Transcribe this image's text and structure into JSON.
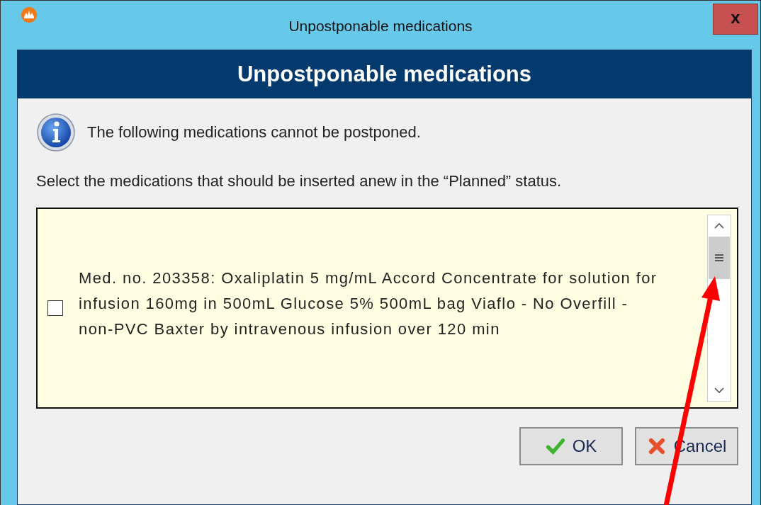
{
  "window": {
    "title": "Unpostponable medications",
    "close": "x"
  },
  "header": "Unpostponable medications",
  "info_text": "The following medications cannot be postponed.",
  "instruction": "Select the medications that should be inserted anew in the “Planned” status.",
  "items": [
    {
      "text": "Med. no. 203358: Oxaliplatin 5 mg/mL Accord Concentrate for solution for infusion 160mg in 500mL Glucose 5% 500mL bag Viaflo - No Overfill - non-PVC Baxter by intravenous infusion over 120 min",
      "checked": false
    }
  ],
  "buttons": [
    {
      "label": "OK",
      "kind": "ok"
    },
    {
      "label": "Cancel",
      "kind": "cancel"
    }
  ]
}
